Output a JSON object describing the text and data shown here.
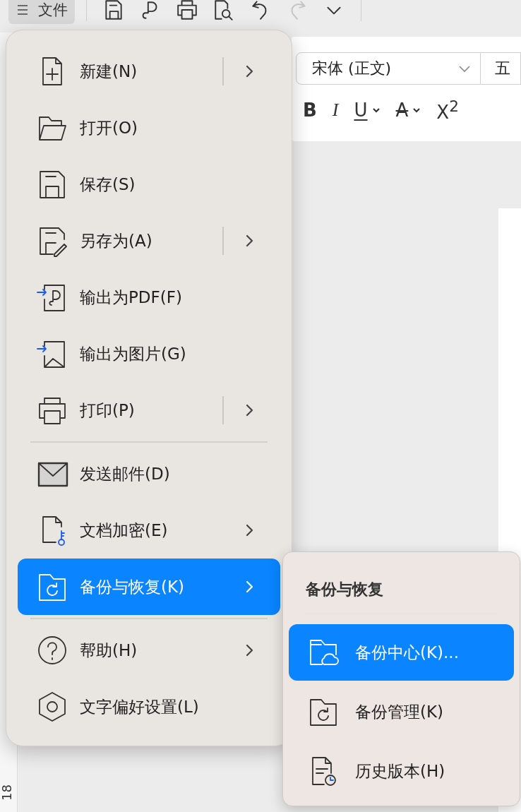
{
  "toolbar": {
    "file_menu": {
      "label": "文件",
      "selected": true
    },
    "quick_access": [
      {
        "kind": "save",
        "disabled": false
      },
      {
        "kind": "loop",
        "disabled": false
      },
      {
        "kind": "print",
        "disabled": false
      },
      {
        "kind": "preview",
        "disabled": false
      },
      {
        "kind": "undo",
        "disabled": false
      },
      {
        "kind": "redo",
        "disabled": true
      },
      {
        "kind": "more",
        "disabled": false
      }
    ]
  },
  "format_bar": {
    "font_field": {
      "value": "宋体 (正文)"
    },
    "size_field": {
      "value": "五"
    },
    "buttons": [
      {
        "kind": "bold",
        "label": "B",
        "has_dropdown": false
      },
      {
        "kind": "italic",
        "label": "I",
        "has_dropdown": false
      },
      {
        "kind": "underline",
        "label": "U",
        "has_dropdown": true
      },
      {
        "kind": "strikethrough",
        "label": "A",
        "has_dropdown": true
      },
      {
        "kind": "superscript",
        "label": "X$^{2}$",
        "has_dropdown": false
      }
    ]
  },
  "ruler": {
    "labels": [
      "18"
    ]
  },
  "menu": {
    "groups": [
      {
        "items": [
          {
            "kind": "new",
            "label": "新建(N)",
            "submenu": true,
            "split": true,
            "selected": false
          },
          {
            "kind": "open",
            "label": "打开(O)",
            "submenu": false,
            "split": false,
            "selected": false
          },
          {
            "kind": "save",
            "label": "保存(S)",
            "submenu": false,
            "split": false,
            "selected": false
          },
          {
            "kind": "save_as",
            "label": "另存为(A)",
            "submenu": true,
            "split": true,
            "selected": false
          },
          {
            "kind": "pdf",
            "label": "输出为PDF(F)",
            "submenu": false,
            "split": false,
            "selected": false
          },
          {
            "kind": "image",
            "label": "输出为图片(G)",
            "submenu": false,
            "split": false,
            "selected": false
          },
          {
            "kind": "print",
            "label": "打印(P)",
            "submenu": true,
            "split": true,
            "selected": false
          }
        ]
      },
      {
        "items": [
          {
            "kind": "mail",
            "label": "发送邮件(D)",
            "submenu": false,
            "split": false,
            "selected": false
          },
          {
            "kind": "encrypt",
            "label": "文档加密(E)",
            "submenu": true,
            "split": false,
            "selected": false
          },
          {
            "kind": "backup",
            "label": "备份与恢复(K)",
            "submenu": true,
            "split": false,
            "selected": true
          }
        ]
      },
      {
        "items": [
          {
            "kind": "help",
            "label": "帮助(H)",
            "submenu": true,
            "split": false,
            "selected": false
          },
          {
            "kind": "prefs",
            "label": "文字偏好设置(L)",
            "submenu": false,
            "split": false,
            "selected": false
          }
        ]
      }
    ]
  },
  "submenu": {
    "title": "备份与恢复",
    "items": [
      {
        "kind": "cloud_folder",
        "label": "备份中心(K)...",
        "selected": true
      },
      {
        "kind": "backup",
        "label": "备份管理(K)",
        "selected": false
      },
      {
        "kind": "history",
        "label": "历史版本(H)",
        "selected": false
      }
    ]
  }
}
